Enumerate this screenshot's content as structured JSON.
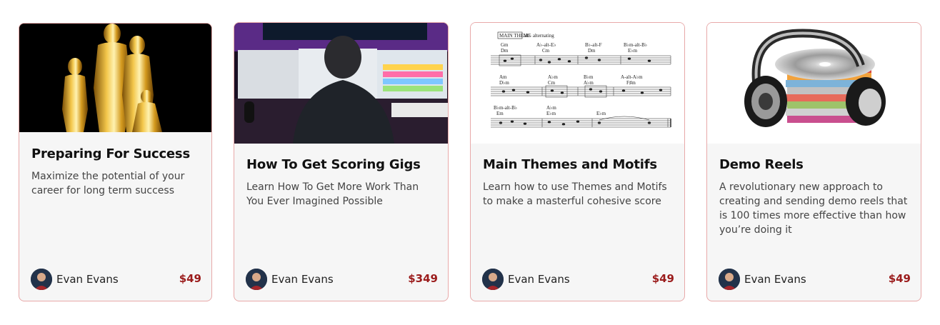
{
  "courses": [
    {
      "title": "Preparing For Success",
      "description": "Maximize the potential of your career for long term success",
      "author": "Evan Evans",
      "price": "$49",
      "image": "oscar-statues-image"
    },
    {
      "title": "How To Get Scoring Gigs",
      "description": "Learn How To Get More Work Than You Ever Imagined Possible",
      "author": "Evan Evans",
      "price": "$349",
      "image": "studio-workstation-image"
    },
    {
      "title": "Main Themes and Motifs",
      "description": "Learn how to use Themes and Motifs to make a masterful cohesive score",
      "author": "Evan Evans",
      "price": "$49",
      "image": "sheet-music-image"
    },
    {
      "title": "Demo Reels",
      "description": "A revolutionary new approach to creating and sending demo reels that is 100 times more effective than how you’re doing it",
      "author": "Evan Evans",
      "price": "$49",
      "image": "headphones-cds-image"
    }
  ],
  "sheet_music": {
    "heading": "MAIN THEME",
    "heading_note": "alt - alternating",
    "row1": [
      "Gm",
      "Dm",
      "A♭-alt-E♭",
      "Cm",
      "B♭-alt-F",
      "Dm",
      "B♭m-alt-B♭",
      "E♭m"
    ],
    "row2": [
      "Am",
      "D♭m",
      "A♭m",
      "Cm",
      "B♭m",
      "A♭m",
      "A-alt-A♭m",
      "F♯m"
    ],
    "row3": [
      "B♭m-alt-B♭",
      "Em",
      "A♭m",
      "E♭m",
      "E♭m"
    ]
  },
  "colors": {
    "price": "#9b1c1c",
    "border": "#e8a9a9",
    "card_bg": "#f6f6f6"
  }
}
